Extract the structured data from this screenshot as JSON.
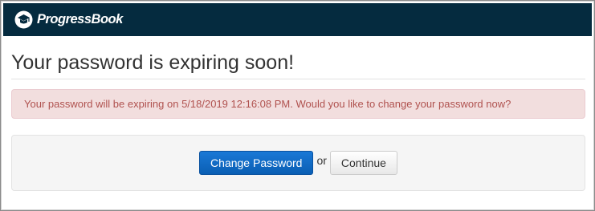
{
  "header": {
    "brand_name": "ProgressBook",
    "logo_icon": "progressbook-logo-icon",
    "background_color": "#052b3f"
  },
  "main": {
    "title": "Your password is expiring soon!",
    "alert": {
      "message": "Your password will be expiring on 5/18/2019 12:16:08 PM. Would you like to change your password now?",
      "background_color": "#f2dede",
      "text_color": "#b0524f"
    },
    "actions": {
      "change_password_label": "Change Password",
      "separator_text": "or",
      "continue_label": "Continue"
    }
  }
}
